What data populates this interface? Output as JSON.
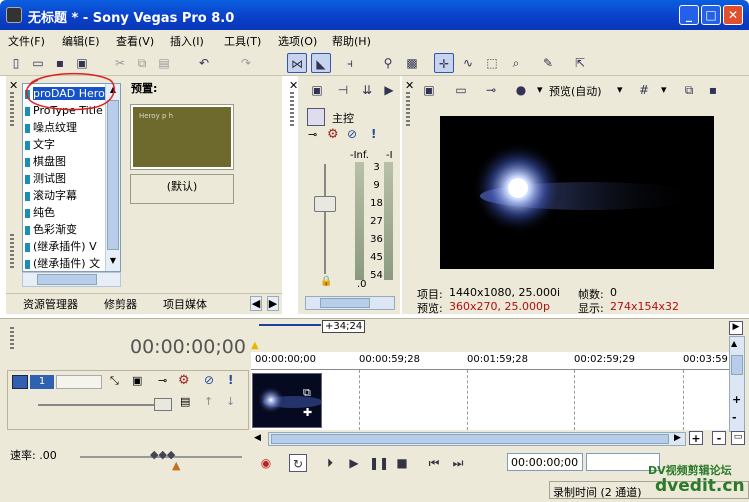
{
  "window": {
    "title": "无标题 * - Sony Vegas Pro 8.0",
    "min": "_",
    "max": "□",
    "close": "✕"
  },
  "menu": [
    "文件(F)",
    "编辑(E)",
    "查看(V)",
    "插入(I)",
    "工具(T)",
    "选项(O)",
    "帮助(H)"
  ],
  "tree": {
    "items": [
      "proDAD Hero",
      "ProType Title",
      "噪点纹理",
      "文字",
      "棋盘图",
      "测试图",
      "滚动字幕",
      "纯色",
      "色彩渐变",
      "(继承插件) V",
      "(继承插件) 文"
    ]
  },
  "presets": {
    "label": "预置:",
    "default_name": "(默认)",
    "thumb_text": "Heroy  p   h"
  },
  "tabs": [
    "资源管理器",
    "修剪器",
    "项目媒体"
  ],
  "mixer": {
    "master_label": "主控",
    "inf_label": "-Inf.",
    "scale": [
      "3",
      "9",
      "18",
      "27",
      "36",
      "45",
      "54"
    ],
    "bottom_value": ".0"
  },
  "preview": {
    "mode_label": "预览(自动)",
    "project_label": "项目:",
    "project_value": "1440x1080, 25.000i",
    "frame_label": "帧数:",
    "frame_value": "0",
    "preview_label": "预览:",
    "preview_value": "360x270, 25.000p",
    "display_label": "显示:",
    "display_value": "274x154x32"
  },
  "timeline": {
    "timecode": "00:00:00;00",
    "cursor_delta": "+34;24",
    "ruler": [
      "00:00:00;00",
      "00:00:59;28",
      "00:01:59;28",
      "00:02:59;29",
      "00:03:59"
    ],
    "track_number": "1",
    "rate": "速率: .00",
    "transport_tc": "00:00:00;00"
  },
  "status": {
    "text": "录制时间 (2 通道)"
  },
  "watermark": {
    "line1": "DV视频剪辑论坛",
    "line2": "dvedit.cn"
  },
  "colors": {
    "titlebar": "#0a4fd6",
    "selection": "#1652c8",
    "annotation": "#e02020",
    "accent_red": "#b01010"
  }
}
